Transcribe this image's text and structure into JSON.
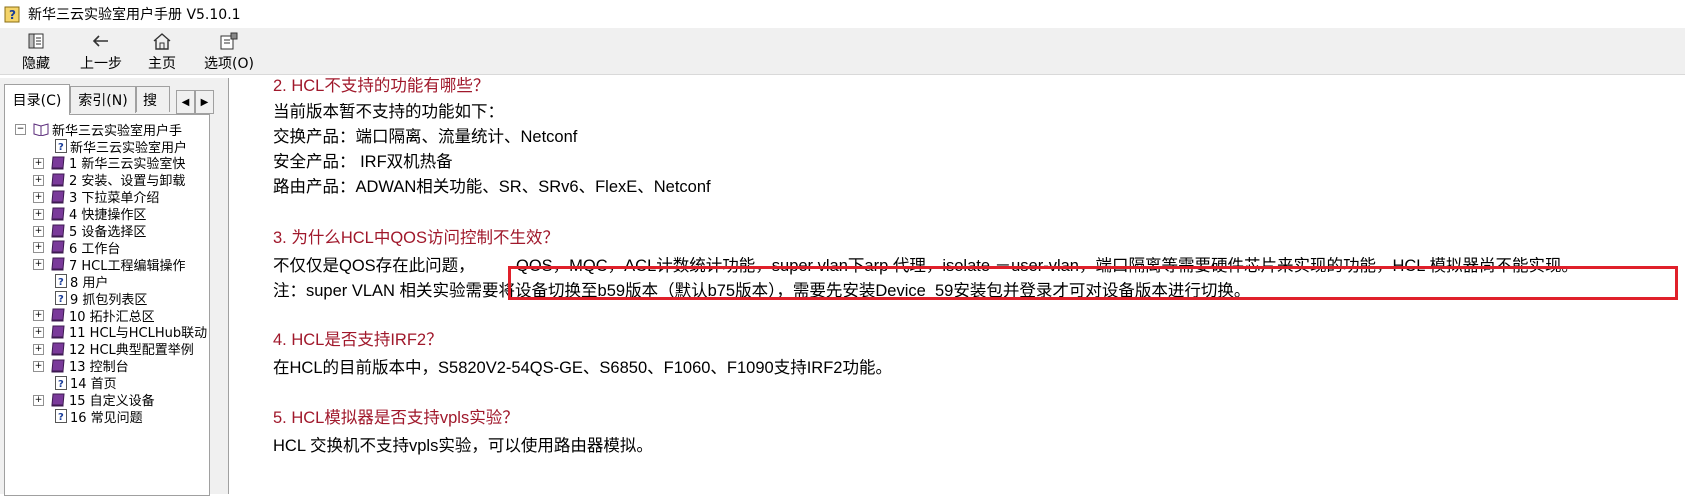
{
  "window": {
    "title": "新华三云实验室用户手册 V5.10.1"
  },
  "toolbar": {
    "buttons": [
      {
        "label": "隐藏",
        "icon": "hide-icon"
      },
      {
        "label": "上一步",
        "icon": "back-arrow-icon"
      },
      {
        "label": "主页",
        "icon": "home-icon"
      },
      {
        "label": "选项(O)",
        "icon": "options-icon"
      }
    ]
  },
  "nav": {
    "tabs": [
      {
        "label": "目录(C)"
      },
      {
        "label": "索引(N)"
      },
      {
        "label": "搜"
      }
    ],
    "tree": {
      "root": {
        "label": "新华三云实验室用户手",
        "icon": "open-book-icon"
      },
      "items": [
        {
          "label": "新华三云实验室用户",
          "icon": "help-page-icon",
          "expand": ""
        },
        {
          "label": "1 新华三云实验室快",
          "icon": "book-icon",
          "expand": "+"
        },
        {
          "label": "2 安装、设置与卸载",
          "icon": "book-icon",
          "expand": "+"
        },
        {
          "label": "3 下拉菜单介绍",
          "icon": "book-icon",
          "expand": "+"
        },
        {
          "label": "4 快捷操作区",
          "icon": "book-icon",
          "expand": "+"
        },
        {
          "label": "5 设备选择区",
          "icon": "book-icon",
          "expand": "+"
        },
        {
          "label": "6 工作台",
          "icon": "book-icon",
          "expand": "+"
        },
        {
          "label": "7 HCL工程编辑操作",
          "icon": "book-icon",
          "expand": "+"
        },
        {
          "label": "8 用户",
          "icon": "help-page-icon",
          "expand": ""
        },
        {
          "label": "9 抓包列表区",
          "icon": "help-page-icon",
          "expand": ""
        },
        {
          "label": "10 拓扑汇总区",
          "icon": "book-icon",
          "expand": "+"
        },
        {
          "label": "11 HCL与HCLHub联动",
          "icon": "book-icon",
          "expand": "+"
        },
        {
          "label": "12 HCL典型配置举例",
          "icon": "book-icon",
          "expand": "+"
        },
        {
          "label": "13 控制台",
          "icon": "book-icon",
          "expand": "+"
        },
        {
          "label": "14 首页",
          "icon": "help-page-icon",
          "expand": ""
        },
        {
          "label": "15 自定义设备",
          "icon": "book-icon",
          "expand": "+"
        },
        {
          "label": "16 常见问题",
          "icon": "help-page-icon",
          "expand": ""
        }
      ]
    }
  },
  "content": {
    "lines": [
      {
        "text": "2. HCL不支持的功能有哪些？",
        "kind": "heading"
      },
      {
        "text": "当前版本暂不支持的功能如下：",
        "kind": "body"
      },
      {
        "text": "交换产品：端口隔离、流量统计、Netconf",
        "kind": "body"
      },
      {
        "text": "安全产品： IRF双机热备",
        "kind": "body"
      },
      {
        "text": "路由产品：ADWAN相关功能、SR、SRv6、FlexE、Netconf",
        "kind": "body"
      },
      {
        "text": "3. 为什么HCL中QOS访问控制不生效？",
        "kind": "heading"
      },
      {
        "text": "不仅仅是QOS存在此问题，",
        "kind": "body"
      },
      {
        "text": "QOS，MQC，ACL计数统计功能，super vlan下arp 代理，isolate －user-vlan，端口隔离等需要硬件芯片来实现的功能，HCL 模拟器尚不能实现。",
        "kind": "highlight"
      },
      {
        "text": "注：super VLAN 相关实验需要将设备切换至b59版本（默认b75版本），需要先安装Device_59安装包并登录才可对设备版本进行切换。",
        "kind": "body"
      },
      {
        "text": "4. HCL是否支持IRF2？",
        "kind": "heading"
      },
      {
        "text": "在HCL的目前版本中，S5820V2-54QS-GE、S6850、F1060、F1090支持IRF2功能。",
        "kind": "body"
      },
      {
        "text": "5. HCL模拟器是否支持vpls实验？",
        "kind": "heading"
      },
      {
        "text": "HCL 交换机不支持vpls实验，可以使用路由器模拟。",
        "kind": "body"
      }
    ]
  },
  "colors": {
    "heading": "#a0182b",
    "highlight_border": "#e0202a",
    "chrome": "#f0f0f0"
  }
}
